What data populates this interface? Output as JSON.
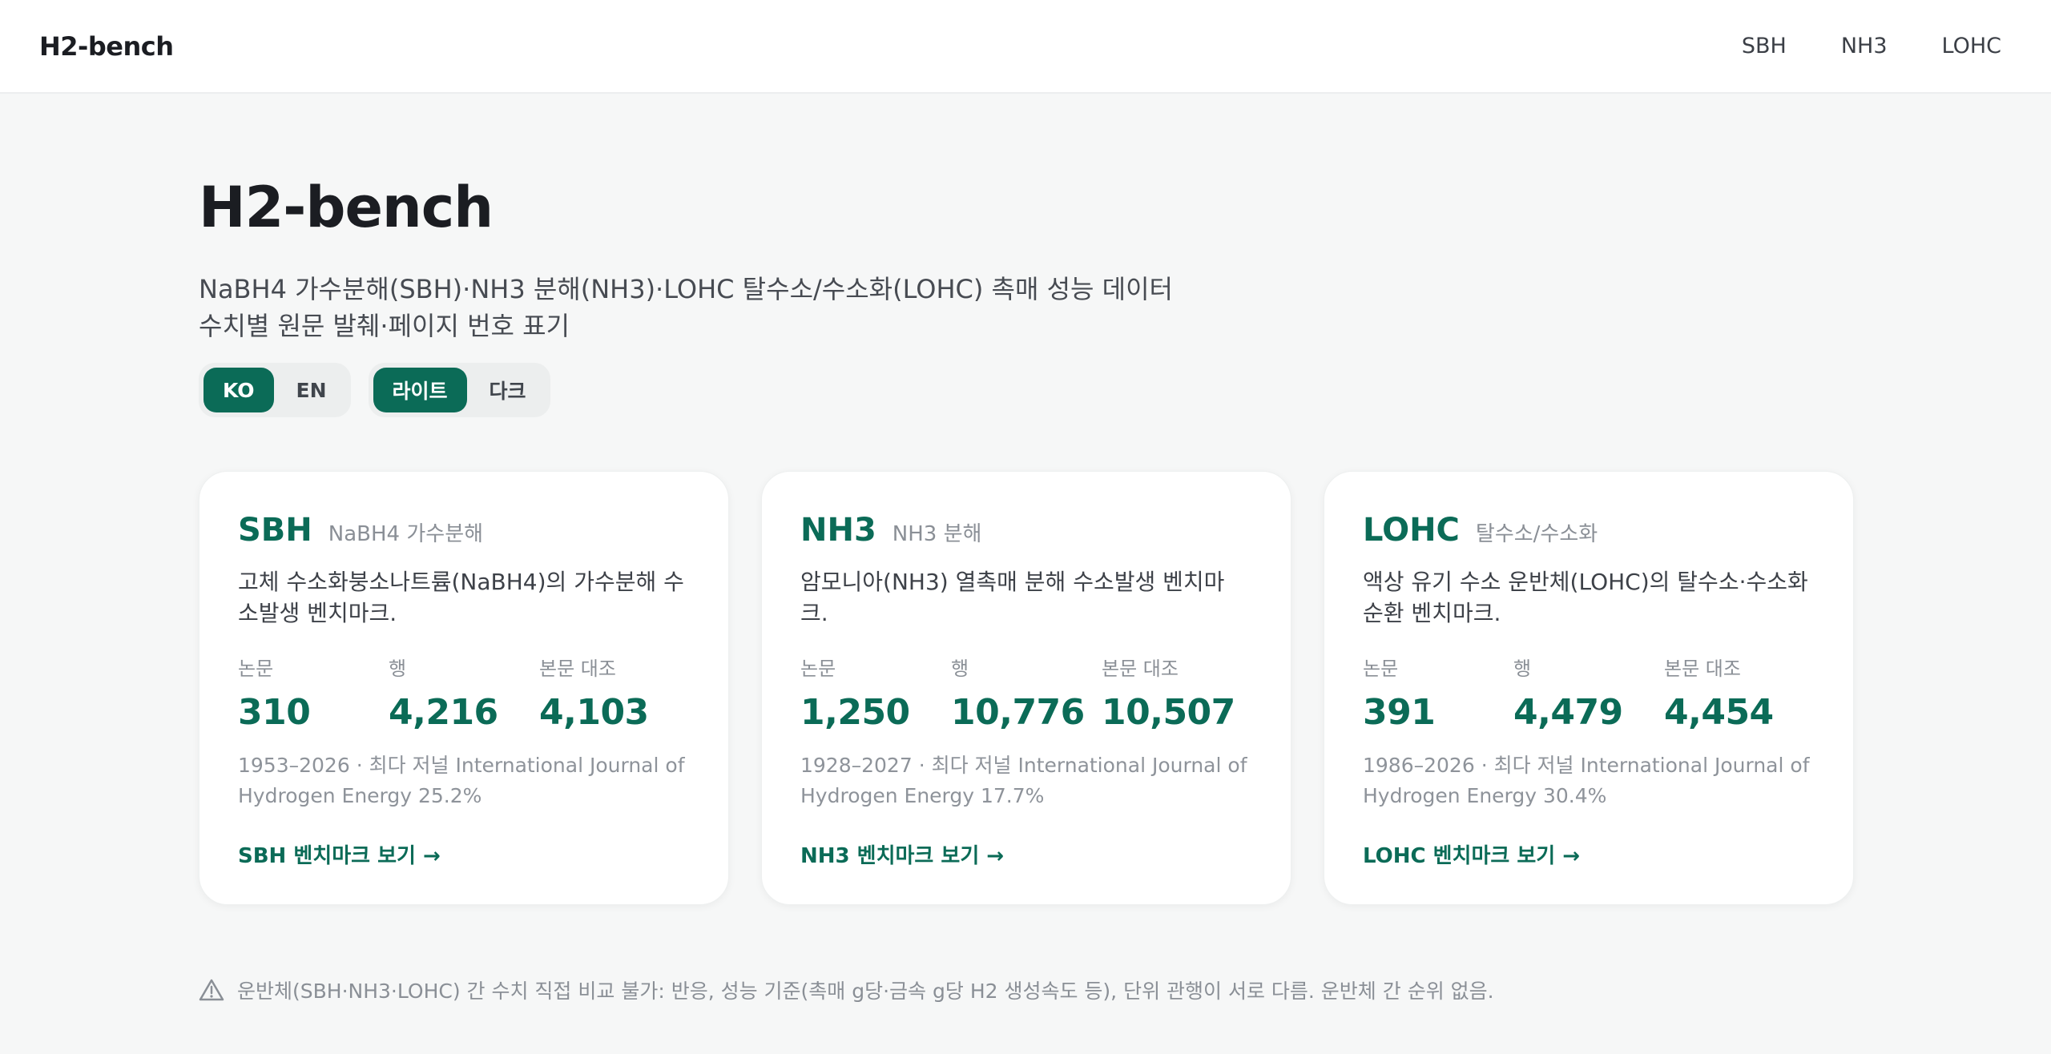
{
  "header": {
    "brand": "H2-bench",
    "nav": [
      "SBH",
      "NH3",
      "LOHC"
    ]
  },
  "hero": {
    "title": "H2-bench",
    "subtitle_line1": "NaBH4 가수분해(SBH)·NH3 분해(NH3)·LOHC 탈수소/수소화(LOHC) 촉매 성능 데이터",
    "subtitle_line2": "수치별 원문 발췌·페이지 번호 표기"
  },
  "toggles": {
    "language": {
      "options": [
        "KO",
        "EN"
      ],
      "selected": "KO"
    },
    "theme": {
      "options": [
        "라이트",
        "다크"
      ],
      "selected": "라이트"
    }
  },
  "stat_labels": {
    "papers": "논문",
    "rows": "행",
    "verified": "본문 대조"
  },
  "cards": [
    {
      "code": "SBH",
      "subtitle": "NaBH4 가수분해",
      "description": "고체 수소화붕소나트륨(NaBH4)의 가수분해 수소발생 벤치마크.",
      "papers": "310",
      "rows": "4,216",
      "verified": "4,103",
      "meta": "1953–2026 · 최다 저널 International Journal of Hydrogen Energy 25.2%",
      "link": "SBH 벤치마크 보기 →"
    },
    {
      "code": "NH3",
      "subtitle": "NH3 분해",
      "description": "암모니아(NH3) 열촉매 분해 수소발생 벤치마크.",
      "papers": "1,250",
      "rows": "10,776",
      "verified": "10,507",
      "meta": "1928–2027 · 최다 저널 International Journal of Hydrogen Energy 17.7%",
      "link": "NH3 벤치마크 보기 →"
    },
    {
      "code": "LOHC",
      "subtitle": "탈수소/수소화",
      "description": "액상 유기 수소 운반체(LOHC)의 탈수소·수소화 순환 벤치마크.",
      "papers": "391",
      "rows": "4,479",
      "verified": "4,454",
      "meta": "1986–2026 · 최다 저널 International Journal of Hydrogen Energy 30.4%",
      "link": "LOHC 벤치마크 보기 →"
    }
  ],
  "notice": {
    "icon": "warning-icon",
    "text": "운반체(SBH·NH3·LOHC) 간 수치 직접 비교 불가: 반응, 성능 기준(촉매 g당·금속 g당 H2 생성속도 등), 단위 관행이 서로 다름. 운반체 간 순위 없음."
  },
  "colors": {
    "accent": "#0b6b57",
    "background": "#f6f7f7",
    "card": "#ffffff"
  }
}
